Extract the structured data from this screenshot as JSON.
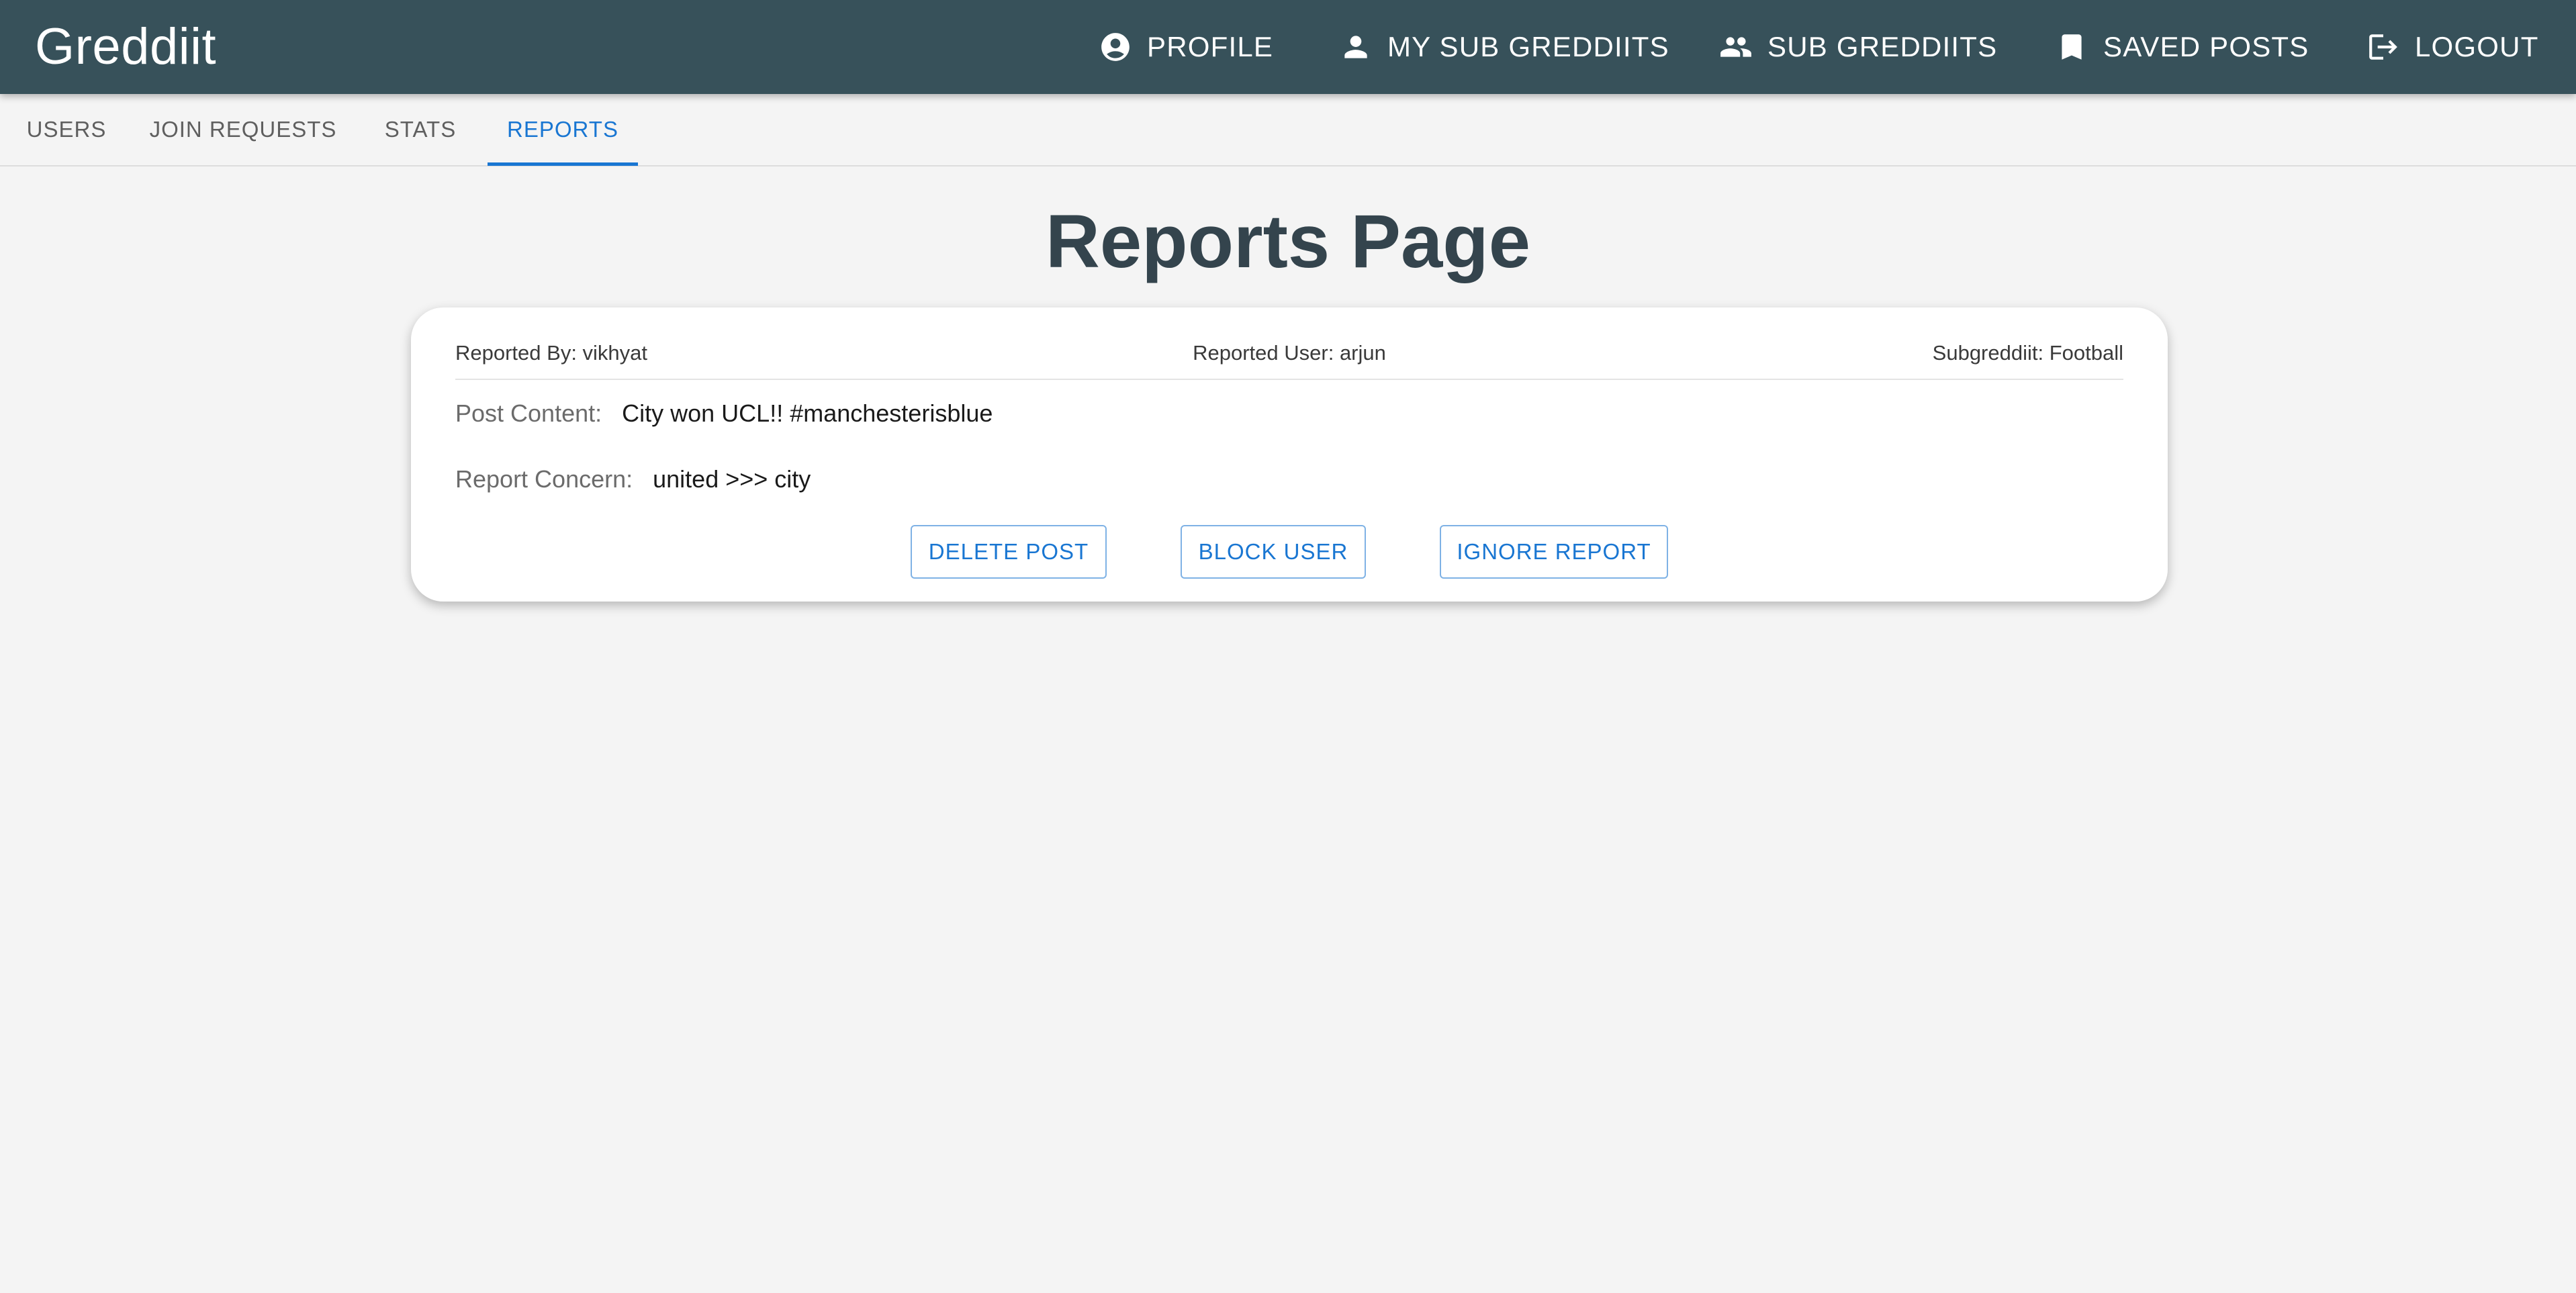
{
  "app": {
    "title": "Greddiit"
  },
  "nav": {
    "profile": "PROFILE",
    "my_sub_greddiits": "MY SUB GREDDIITS",
    "sub_greddiits": "SUB GREDDIITS",
    "saved_posts": "SAVED POSTS",
    "logout": "LOGOUT"
  },
  "tabs": {
    "users": "USERS",
    "join_requests": "JOIN REQUESTS",
    "stats": "STATS",
    "reports": "REPORTS",
    "active": "REPORTS"
  },
  "page": {
    "title": "Reports Page"
  },
  "report": {
    "reported_by": "Reported By: vikhyat",
    "reported_user": "Reported User: arjun",
    "subgreddiit": "Subgreddiit: Football",
    "post_content_label": "Post Content:",
    "post_content": "City won UCL!! #manchesterisblue",
    "concern_label": "Report Concern:",
    "concern": "united >>> city",
    "actions": {
      "delete": "DELETE POST",
      "block": "BLOCK USER",
      "ignore": "IGNORE REPORT"
    }
  },
  "colors": {
    "appbar": "#37515a",
    "accent": "#1976d2",
    "background": "#f4f4f4",
    "title": "#34444d"
  },
  "icons": {
    "profile": "account-circle-icon",
    "my_sub_greddiits": "person-icon",
    "sub_greddiits": "people-icon",
    "saved_posts": "bookmark-icon",
    "logout": "logout-icon"
  }
}
